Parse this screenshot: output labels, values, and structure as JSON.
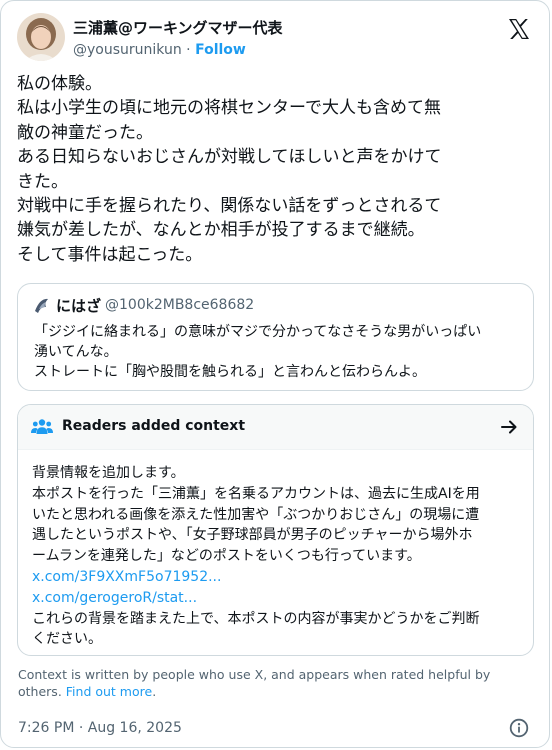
{
  "author": {
    "name": "三浦薫@ワーキングマザー代表",
    "handle": "@yousurunikun",
    "separator": "·",
    "follow": "Follow"
  },
  "tweet_lines": [
    "私の体験。",
    "私は小学生の頃に地元の将棋センターで大人も含めて無",
    "敵の神童だった。",
    "ある日知らないおじさんが対戦してほしいと声をかけて",
    "きた。",
    "対戦中に手を握られたり、関係ない話をずっとされるて",
    "嫌気が差したが、なんとか相手が投了するまで継続。",
    "そして事件は起こった。"
  ],
  "quote": {
    "name": "にはざ",
    "handle": "@100k2MB8ce68682",
    "lines": [
      "「ジジイに絡まれる」の意味がマジで分かってなさそうな男がいっぱい",
      "湧いてんな。",
      "ストレートに「胸や股間を触られる」と言わんと伝わらんよ。"
    ]
  },
  "context": {
    "title": "Readers added context",
    "lines": [
      "背景情報を追加します。",
      "本ポストを行った「三浦薫」を名乗るアカウントは、過去に生成AIを用",
      "いたと思われる画像を添えた性加害や「ぶつかりおじさん」の現場に遭",
      "遇したというポストや、「女子野球部員が男子のピッチャーから場外ホ",
      "ームランを連発した」などのポストをいくつも行っています。"
    ],
    "link1": "x.com/3F9XXmF5o71952...",
    "link2": "x.com/gerogeroR/stat...",
    "closing_lines": [
      "これらの背景を踏まえた上で、本ポストの内容が事実かどうかをご判断",
      "ください。"
    ]
  },
  "footnote": {
    "text": "Context is written by people who use X, and appears when rated helpful by others. ",
    "link": "Find out more",
    "end": "."
  },
  "timestamp": "7:26 PM · Aug 16, 2025",
  "colors": {
    "accent": "#1d9bf0",
    "muted": "#536471",
    "border": "#cfd9de"
  },
  "icons": [
    "x-logo-icon",
    "people-icon",
    "arrow-right-icon",
    "info-icon"
  ]
}
